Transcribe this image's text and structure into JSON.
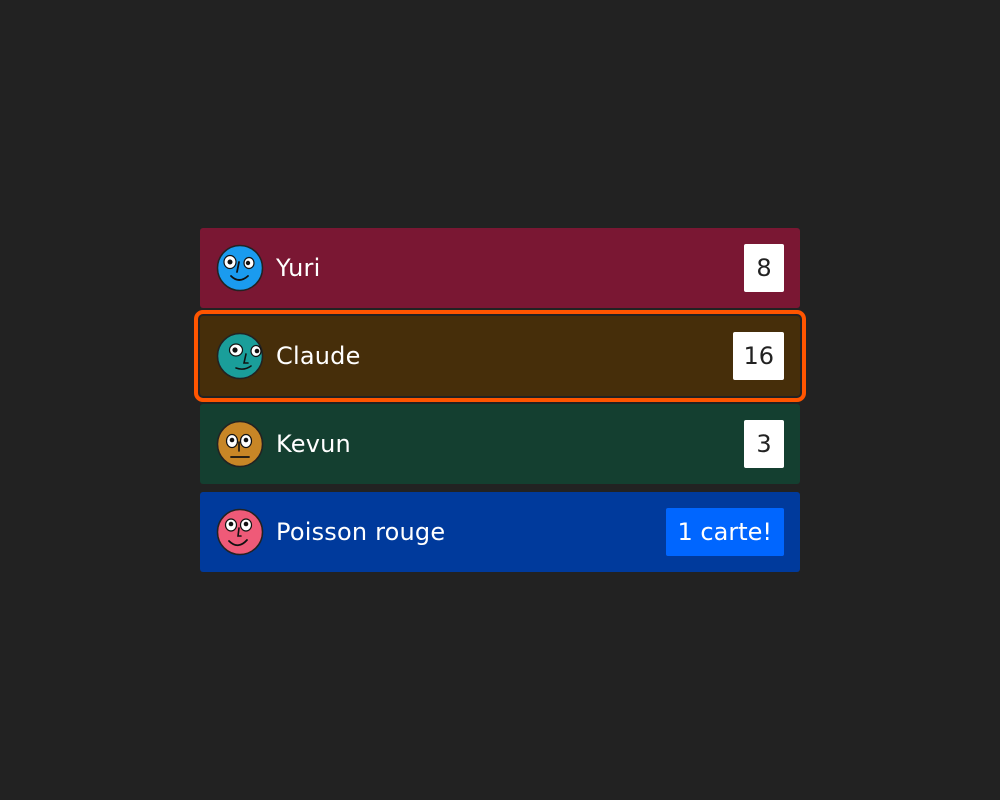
{
  "players": [
    {
      "name": "Yuri",
      "cards": "8",
      "row_color": "#7a1733",
      "avatar_color": "#1a9bef",
      "avatar_icon": "face-avatar-icon",
      "active": false,
      "alert": false
    },
    {
      "name": "Claude",
      "cards": "16",
      "row_color": "#462e0a",
      "avatar_color": "#1a9e9a",
      "avatar_icon": "face-avatar-icon",
      "active": true,
      "alert": false
    },
    {
      "name": "Kevun",
      "cards": "3",
      "row_color": "#143f30",
      "avatar_color": "#c88626",
      "avatar_icon": "face-avatar-icon",
      "active": false,
      "alert": false
    },
    {
      "name": "Poisson rouge",
      "cards": "1 carte!",
      "row_color": "#003a9c",
      "avatar_color": "#ef5a78",
      "avatar_icon": "face-avatar-icon",
      "active": false,
      "alert": true
    }
  ],
  "colors": {
    "background": "#222222",
    "active_outline": "#ff5500",
    "alert_badge": "#0066ff"
  }
}
